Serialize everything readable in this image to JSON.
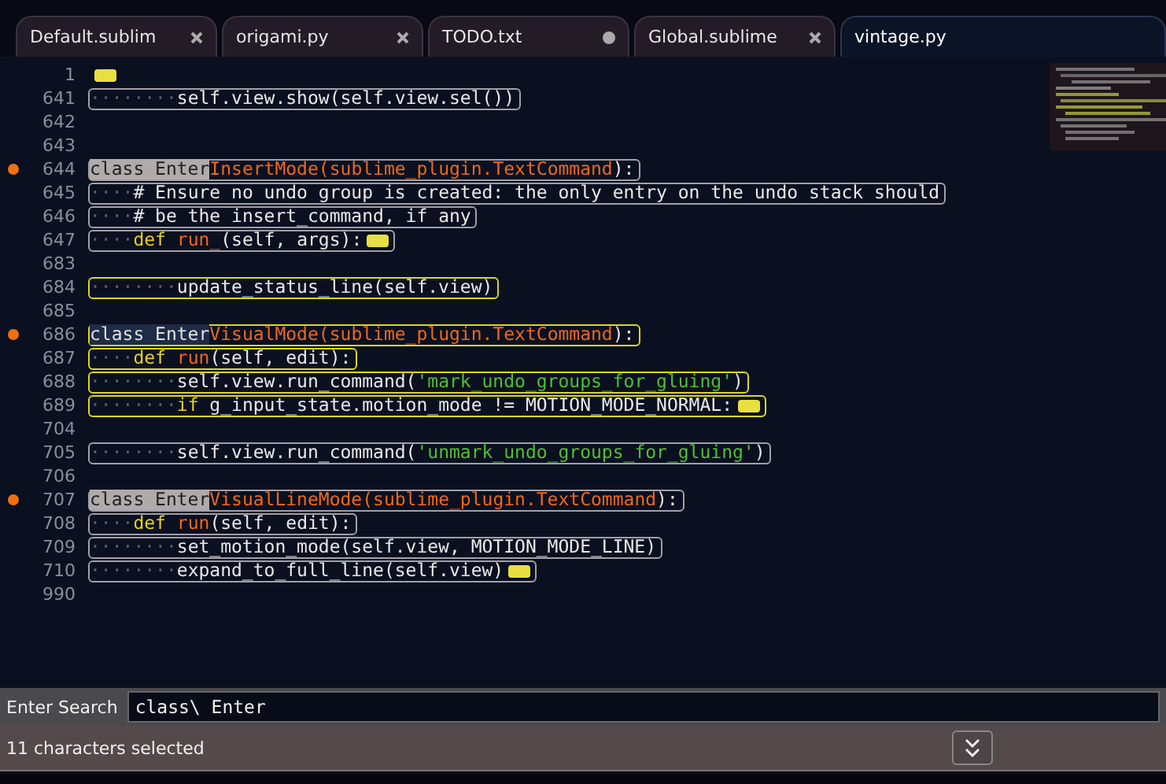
{
  "tabs": [
    {
      "label": "Default.sublim",
      "selected": false,
      "modified": false
    },
    {
      "label": "origami.py",
      "selected": false,
      "modified": false
    },
    {
      "label": "TODO.txt",
      "selected": false,
      "modified": true
    },
    {
      "label": "Global.sublime",
      "selected": false,
      "modified": false
    },
    {
      "label": "vintage.py",
      "selected": true,
      "modified": false
    }
  ],
  "lines": [
    {
      "number": "1",
      "bookmarked": false,
      "outlined": false,
      "active": false,
      "folded": true
    },
    {
      "number": "641",
      "bookmarked": false,
      "outlined": true,
      "active": false,
      "folded": false,
      "tokens": [
        {
          "text": "········",
          "kind": "ws"
        },
        {
          "text": "self.view.show(self.view.sel())",
          "kind": "plain"
        }
      ]
    },
    {
      "number": "642",
      "bookmarked": false,
      "folded": false
    },
    {
      "number": "643",
      "bookmarked": false,
      "folded": false
    },
    {
      "number": "644",
      "bookmarked": true,
      "outlined": true,
      "active": false,
      "folded": false,
      "tokens": [
        {
          "text": "class Enter",
          "kind": "match"
        },
        {
          "text": "InsertMode(",
          "kind": "name"
        },
        {
          "text": "sublime_plugin.TextCommand",
          "kind": "name"
        },
        {
          "text": "):",
          "kind": "plain"
        }
      ]
    },
    {
      "number": "645",
      "bookmarked": false,
      "outlined": true,
      "active": false,
      "folded": false,
      "tokens": [
        {
          "text": "····",
          "kind": "ws"
        },
        {
          "text": "# Ensure no undo group is created: the only entry on the undo stack should",
          "kind": "plain"
        }
      ]
    },
    {
      "number": "646",
      "bookmarked": false,
      "outlined": true,
      "active": false,
      "folded": false,
      "tokens": [
        {
          "text": "····",
          "kind": "ws"
        },
        {
          "text": "# be the insert_command, if any",
          "kind": "plain"
        }
      ]
    },
    {
      "number": "647",
      "bookmarked": false,
      "outlined": true,
      "active": false,
      "folded": true,
      "tokens": [
        {
          "text": "····",
          "kind": "ws"
        },
        {
          "text": "def ",
          "kind": "keyword"
        },
        {
          "text": "run_",
          "kind": "name"
        },
        {
          "text": "(self, args):",
          "kind": "plain"
        }
      ]
    },
    {
      "number": "683",
      "bookmarked": false,
      "folded": false
    },
    {
      "number": "684",
      "bookmarked": false,
      "outlined": true,
      "active": true,
      "folded": false,
      "tokens": [
        {
          "text": "········",
          "kind": "ws"
        },
        {
          "text": "update_status_line(self.view)",
          "kind": "plain"
        }
      ]
    },
    {
      "number": "685",
      "bookmarked": false,
      "folded": false
    },
    {
      "number": "686",
      "bookmarked": true,
      "outlined": true,
      "active": true,
      "folded": false,
      "tokens": [
        {
          "text": "class Enter",
          "kind": "selection"
        },
        {
          "text": "VisualMode(",
          "kind": "name"
        },
        {
          "text": "sublime_plugin.TextCommand",
          "kind": "name"
        },
        {
          "text": "):",
          "kind": "plain"
        }
      ]
    },
    {
      "number": "687",
      "bookmarked": false,
      "outlined": true,
      "active": true,
      "folded": false,
      "tokens": [
        {
          "text": "····",
          "kind": "ws"
        },
        {
          "text": "def ",
          "kind": "keyword"
        },
        {
          "text": "run",
          "kind": "name"
        },
        {
          "text": "(self, edit):",
          "kind": "plain"
        }
      ]
    },
    {
      "number": "688",
      "bookmarked": false,
      "outlined": true,
      "active": true,
      "folded": false,
      "tokens": [
        {
          "text": "········",
          "kind": "ws"
        },
        {
          "text": "self.view.run_command(",
          "kind": "plain"
        },
        {
          "text": "'mark_undo_groups_for_gluing'",
          "kind": "string"
        },
        {
          "text": ")",
          "kind": "plain"
        }
      ]
    },
    {
      "number": "689",
      "bookmarked": false,
      "outlined": true,
      "active": true,
      "folded": true,
      "tokens": [
        {
          "text": "········",
          "kind": "ws"
        },
        {
          "text": "if ",
          "kind": "keyword"
        },
        {
          "text": "g_input_state.motion_mode != MOTION_MODE_NORMAL:",
          "kind": "plain"
        }
      ]
    },
    {
      "number": "704",
      "bookmarked": false,
      "folded": false
    },
    {
      "number": "705",
      "bookmarked": false,
      "outlined": true,
      "active": false,
      "folded": false,
      "tokens": [
        {
          "text": "········",
          "kind": "ws"
        },
        {
          "text": "self.view.run_command(",
          "kind": "plain"
        },
        {
          "text": "'unmark_undo_groups_for_gluing'",
          "kind": "string"
        },
        {
          "text": ")",
          "kind": "plain"
        }
      ]
    },
    {
      "number": "706",
      "bookmarked": false,
      "folded": false
    },
    {
      "number": "707",
      "bookmarked": true,
      "outlined": true,
      "active": false,
      "folded": false,
      "tokens": [
        {
          "text": "class Enter",
          "kind": "match"
        },
        {
          "text": "VisualLineMode(",
          "kind": "name"
        },
        {
          "text": "sublime_plugin.TextCommand",
          "kind": "name"
        },
        {
          "text": "):",
          "kind": "plain"
        }
      ]
    },
    {
      "number": "708",
      "bookmarked": false,
      "outlined": true,
      "active": false,
      "folded": false,
      "tokens": [
        {
          "text": "····",
          "kind": "ws"
        },
        {
          "text": "def ",
          "kind": "keyword"
        },
        {
          "text": "run",
          "kind": "name"
        },
        {
          "text": "(self, edit):",
          "kind": "plain"
        }
      ]
    },
    {
      "number": "709",
      "bookmarked": false,
      "outlined": true,
      "active": false,
      "folded": false,
      "tokens": [
        {
          "text": "········",
          "kind": "ws"
        },
        {
          "text": "set_motion_mode(self.view, MOTION_MODE_LINE)",
          "kind": "plain"
        }
      ]
    },
    {
      "number": "710",
      "bookmarked": false,
      "outlined": true,
      "active": false,
      "folded": true,
      "tokens": [
        {
          "text": "········",
          "kind": "ws"
        },
        {
          "text": "expand_to_full_line(self.view)",
          "kind": "plain"
        }
      ]
    },
    {
      "number": "990",
      "bookmarked": false,
      "folded": false
    }
  ],
  "find_panel": {
    "label": "Enter Search",
    "value": "class\\ Enter"
  },
  "status_bar": {
    "text": "11 characters selected"
  }
}
